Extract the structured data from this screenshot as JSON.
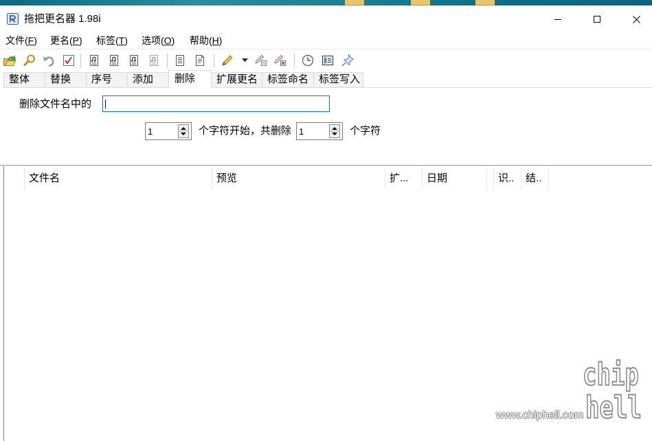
{
  "window": {
    "title": "拖把更名器 1.98i",
    "app_icon": "app-icon",
    "controls": [
      "minimize-icon",
      "maximize-icon",
      "close-icon"
    ]
  },
  "menu": [
    {
      "prefix": "文件(",
      "accel": "F",
      "suffix": ")"
    },
    {
      "prefix": "更名(",
      "accel": "P",
      "suffix": ")"
    },
    {
      "prefix": "标签(",
      "accel": "T",
      "suffix": ")"
    },
    {
      "prefix": "选项(",
      "accel": "O",
      "suffix": ")"
    },
    {
      "prefix": "帮助(",
      "accel": "H",
      "suffix": ")"
    }
  ],
  "toolbar": [
    {
      "icon": "open-folder-icon"
    },
    {
      "icon": "search-icon"
    },
    {
      "icon": "undo-icon"
    },
    {
      "icon": "checkbox-icon"
    },
    {
      "icon": "music-file-icon"
    },
    {
      "icon": "music-file-icon"
    },
    {
      "icon": "music-file-icon"
    },
    {
      "icon": "music-file-icon"
    },
    {
      "icon": "document-icon"
    },
    {
      "icon": "document-icon"
    },
    {
      "icon": "pen-icon"
    },
    {
      "icon": "dropdown-arrow-icon"
    },
    {
      "icon": "pen-clear-icon"
    },
    {
      "icon": "pen-delete-icon"
    },
    {
      "icon": "clock-icon"
    },
    {
      "icon": "panel-icon"
    },
    {
      "icon": "pin-icon"
    }
  ],
  "tabs": {
    "items": [
      "整体",
      "替换",
      "序号",
      "添加",
      "删除",
      "扩展更名",
      "标签命名",
      "标签写入"
    ],
    "selected": "删除"
  },
  "delete_panel": {
    "label": "删除文件名中的",
    "input_value": "",
    "start_value": "1",
    "text_mid": "个字符开始，共删除",
    "count_value": "1",
    "text_end": "个字符"
  },
  "file_list": {
    "columns": [
      "文件名",
      "预览",
      "扩...",
      "日期",
      "识..",
      "结.."
    ],
    "rows": []
  },
  "watermark": {
    "url": "www.chiphell.com",
    "logo_lines": [
      "chip",
      "hell"
    ]
  },
  "colors": {
    "focus_border": "#0078d7",
    "tab_selected": "#ffffff",
    "tab_unselected": "#f3f3f3"
  }
}
